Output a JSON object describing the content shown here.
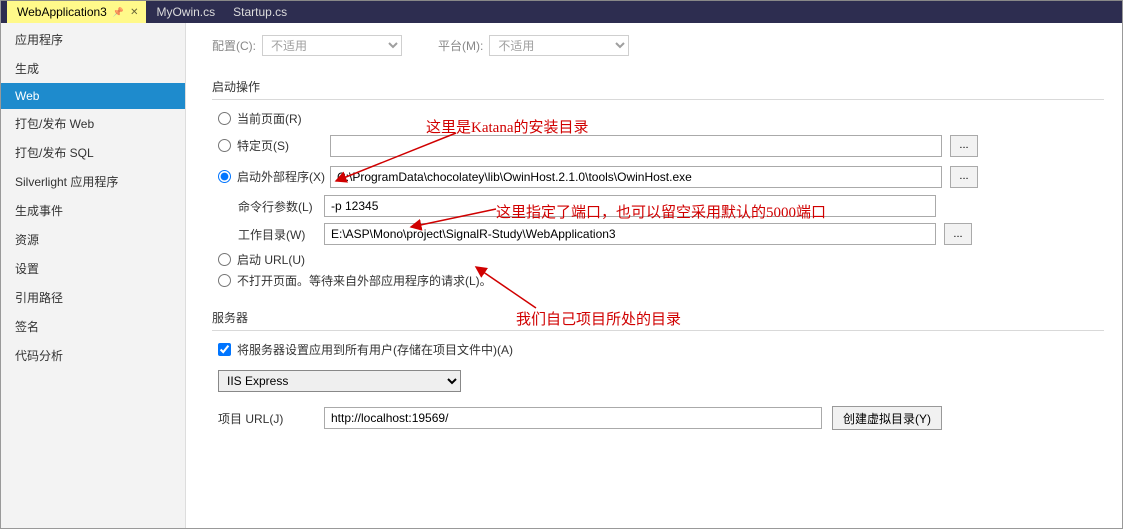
{
  "tabs": [
    {
      "label": "WebApplication3",
      "active": true,
      "pinned": true
    },
    {
      "label": "MyOwin.cs",
      "active": false
    },
    {
      "label": "Startup.cs",
      "active": false
    }
  ],
  "sidebar": {
    "items": [
      "应用程序",
      "生成",
      "Web",
      "打包/发布 Web",
      "打包/发布 SQL",
      "Silverlight 应用程序",
      "生成事件",
      "资源",
      "设置",
      "引用路径",
      "签名",
      "代码分析"
    ],
    "active_index": 2
  },
  "top": {
    "config_label": "配置(C):",
    "config_value": "不适用",
    "platform_label": "平台(M):",
    "platform_value": "不适用"
  },
  "start_action": {
    "title": "启动操作",
    "current_page": "当前页面(R)",
    "specific_page": "特定页(S)",
    "specific_page_value": "",
    "external_program": "启动外部程序(X)",
    "external_program_value": "C:\\ProgramData\\chocolatey\\lib\\OwinHost.2.1.0\\tools\\OwinHost.exe",
    "cmd_args_label": "命令行参数(L)",
    "cmd_args_value": "-p 12345",
    "work_dir_label": "工作目录(W)",
    "work_dir_value": "E:\\ASP\\Mono\\project\\SignalR-Study\\WebApplication3",
    "start_url": "启动 URL(U)",
    "no_open_label": "不打开页面。等待来自外部应用程序的请求(L)。",
    "selected": "external_program"
  },
  "server": {
    "title": "服务器",
    "apply_all": "将服务器设置应用到所有用户(存储在项目文件中)(A)",
    "apply_all_checked": true,
    "select_value": "IIS Express",
    "url_label": "项目 URL(J)",
    "url_value": "http://localhost:19569/",
    "create_vdir": "创建虚拟目录(Y)"
  },
  "buttons": {
    "browse": "..."
  },
  "annotations": {
    "a1": "这里是Katana的安装目录",
    "a2": "这里指定了端口，也可以留空采用默认的5000端口",
    "a3": "我们自己项目所处的目录"
  }
}
